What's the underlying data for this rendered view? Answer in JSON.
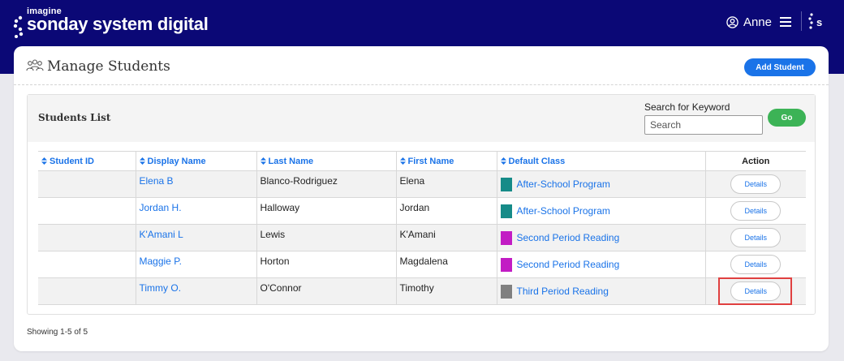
{
  "header": {
    "brand_small": "imagine",
    "brand_main": "sonday system digital",
    "user_name": "Anne",
    "user_icon": "user-circle-icon",
    "menu_icon": "hamburger-menu-icon",
    "logo_icon": "sonday-s-icon"
  },
  "page": {
    "title": "Manage Students",
    "title_icon": "students-group-icon",
    "add_student_label": "Add Student"
  },
  "list": {
    "title": "Students List",
    "search_label": "Search for Keyword",
    "search_placeholder": "Search",
    "search_value": "",
    "go_label": "Go",
    "columns": [
      "Student ID",
      "Display Name",
      "Last Name",
      "First Name",
      "Default Class",
      "Action"
    ],
    "rows": [
      {
        "student_id": "",
        "display_name": "Elena B",
        "last_name": "Blanco-Rodriguez",
        "first_name": "Elena",
        "default_class": "After-School Program",
        "class_color": "#168b88",
        "action": "Details"
      },
      {
        "student_id": "",
        "display_name": "Jordan H.",
        "last_name": "Halloway",
        "first_name": "Jordan",
        "default_class": "After-School Program",
        "class_color": "#168b88",
        "action": "Details"
      },
      {
        "student_id": "",
        "display_name": "K'Amani L",
        "last_name": "Lewis",
        "first_name": "K'Amani",
        "default_class": "Second Period Reading",
        "class_color": "#c21cc4",
        "action": "Details"
      },
      {
        "student_id": "",
        "display_name": "Maggie P.",
        "last_name": "Horton",
        "first_name": "Magdalena",
        "default_class": "Second Period Reading",
        "class_color": "#c21cc4",
        "action": "Details"
      },
      {
        "student_id": "",
        "display_name": "Timmy O.",
        "last_name": "O'Connor",
        "first_name": "Timothy",
        "default_class": "Third Period Reading",
        "class_color": "#808080",
        "action": "Details"
      }
    ],
    "footer": "Showing 1-5 of 5"
  },
  "colors": {
    "header_bg": "#0b0876",
    "link": "#1a73e8",
    "go_button": "#3cb356",
    "highlight": "#e04040"
  }
}
